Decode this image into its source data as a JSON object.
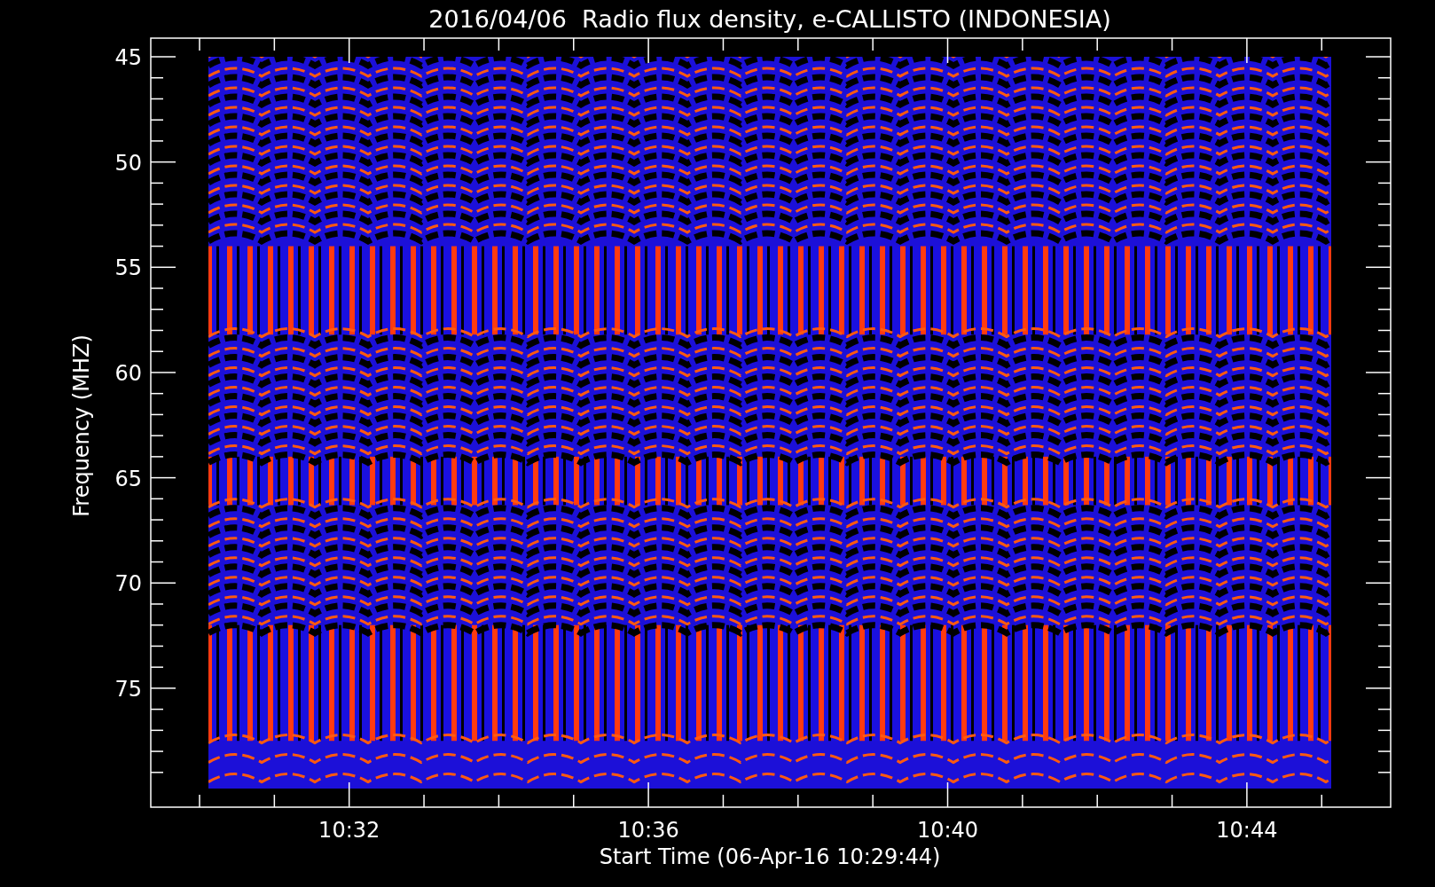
{
  "title": "2016/04/06  Radio flux density, e-CALLISTO (INDONESIA)",
  "y_axis": {
    "label": "Frequency (MHZ)",
    "ticks": [
      "45",
      "50",
      "55",
      "60",
      "65",
      "70",
      "75"
    ]
  },
  "x_axis": {
    "label": "Start Time (06-Apr-16 10:29:44)",
    "ticks": [
      "10:32",
      "10:36",
      "10:40",
      "10:44"
    ]
  }
}
